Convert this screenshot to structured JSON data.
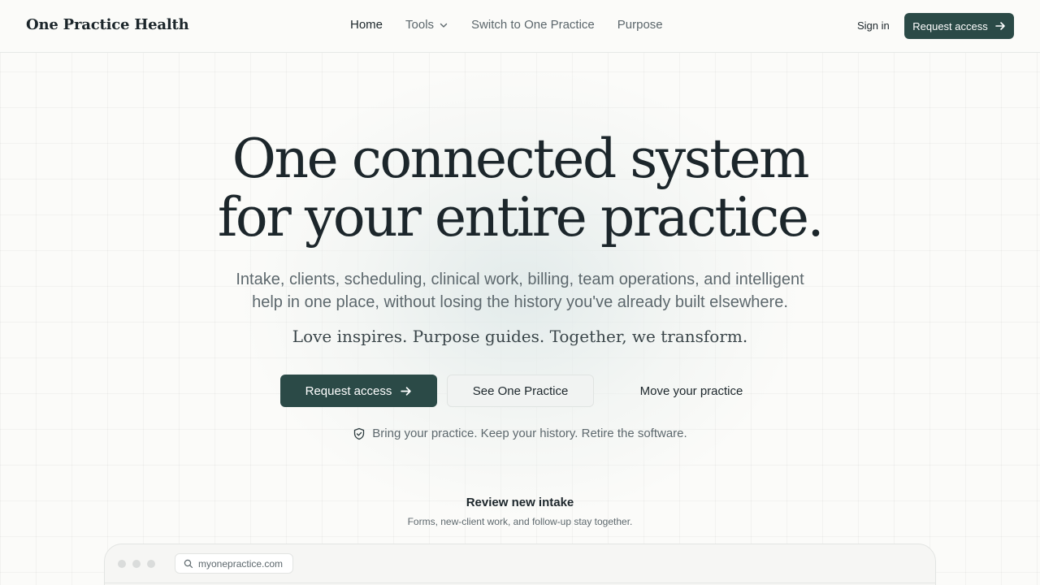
{
  "header": {
    "brand": "One Practice Health",
    "nav": [
      {
        "label": "Home",
        "active": true
      },
      {
        "label": "Tools",
        "has_dropdown": true
      },
      {
        "label": "Switch to One Practice"
      },
      {
        "label": "Purpose"
      }
    ],
    "sign_in": "Sign in",
    "cta": "Request access"
  },
  "hero": {
    "title_line1": "One connected system",
    "title_line2": "for your entire practice.",
    "subtitle_line1": "Intake, clients, scheduling, clinical work, billing, team operations, and intelligent",
    "subtitle_line2": "help in one place, without losing the history you've already built elsewhere.",
    "tagline": "Love inspires. Purpose guides. Together, we transform.",
    "primary_cta": "Request access",
    "secondary_cta": "See One Practice",
    "tertiary_cta": "Move your practice",
    "trust_text": "Bring your practice. Keep your history. Retire the software."
  },
  "preview": {
    "title": "Review new intake",
    "subtitle": "Forms, new-client work, and follow-up stay together.",
    "url": "myonepractice.com"
  },
  "colors": {
    "accent": "#2b4a47",
    "background": "#fbfbf9",
    "text": "#1c262b",
    "muted": "#5d686d"
  },
  "icons": {
    "arrow": "arrow-right-icon",
    "chevron": "chevron-down-icon",
    "shield": "shield-check-icon",
    "search": "search-icon"
  }
}
